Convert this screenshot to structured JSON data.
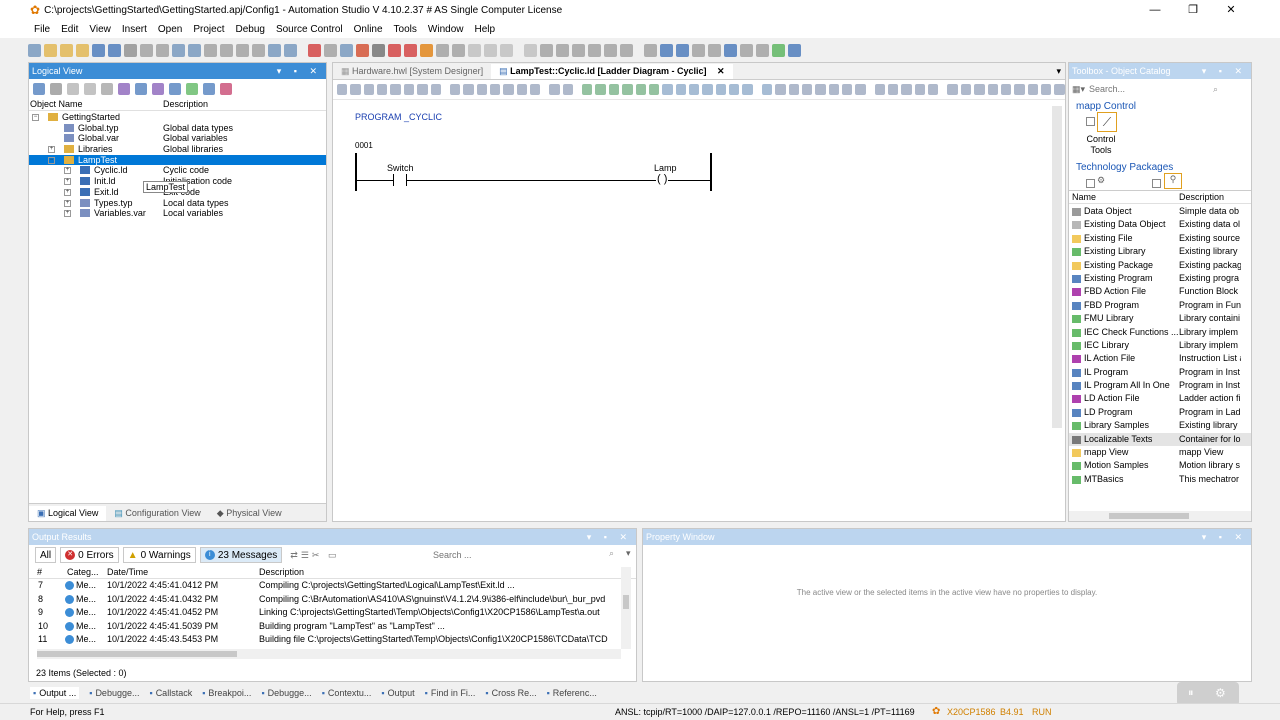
{
  "window": {
    "title": "C:\\projects\\GettingStarted\\GettingStarted.apj/Config1 - Automation Studio V 4.10.2.37 # AS Single Computer License",
    "minimize": "—",
    "maximize": "❐",
    "close": "✕"
  },
  "menu": [
    "File",
    "Edit",
    "View",
    "Insert",
    "Open",
    "Project",
    "Debug",
    "Source Control",
    "Online",
    "Tools",
    "Window",
    "Help"
  ],
  "logical_view": {
    "title": "Logical View",
    "col_object": "Object Name",
    "col_desc": "Description",
    "items": [
      {
        "name": "GettingStarted",
        "desc": "",
        "indent": 0,
        "expander": "−"
      },
      {
        "name": "Global.typ",
        "desc": "Global data types",
        "indent": 1,
        "expander": ""
      },
      {
        "name": "Global.var",
        "desc": "Global variables",
        "indent": 1,
        "expander": ""
      },
      {
        "name": "Libraries",
        "desc": "Global libraries",
        "indent": 1,
        "expander": "+"
      },
      {
        "name": "LampTest",
        "desc": "",
        "indent": 1,
        "expander": "−"
      },
      {
        "name": "Cyclic.ld",
        "desc": "Cyclic code",
        "indent": 2,
        "expander": "+"
      },
      {
        "name": "Init.ld",
        "desc": "Initialisation code",
        "indent": 2,
        "expander": "+"
      },
      {
        "name": "Exit.ld",
        "desc": "Exit code",
        "indent": 2,
        "expander": "+"
      },
      {
        "name": "Types.typ",
        "desc": "Local data types",
        "indent": 2,
        "expander": "+"
      },
      {
        "name": "Variables.var",
        "desc": "Local variables",
        "indent": 2,
        "expander": "+"
      }
    ],
    "tooltip": "LampTest",
    "tabs": [
      "Logical View",
      "Configuration View",
      "Physical View"
    ]
  },
  "editor": {
    "tabs": [
      "Hardware.hwl [System Designer]",
      "LampTest::Cyclic.ld [Ladder Diagram - Cyclic]"
    ],
    "tab_close": "✕",
    "program_label": "PROGRAM _CYCLIC",
    "network": "0001",
    "contact": "Switch",
    "coil": "Lamp",
    "coil_symbol": "( )"
  },
  "toolbox": {
    "title": "Toolbox - Object Catalog",
    "search_placeholder": "Search...",
    "section1": "mapp Control",
    "control_tools": "Control Tools",
    "section2": "Technology Packages",
    "col_name": "Name",
    "col_desc": "Description",
    "items": [
      {
        "name": "Data Object",
        "desc": "Simple data ob",
        "color": "#888888"
      },
      {
        "name": "Existing Data Object",
        "desc": "Existing data ol",
        "color": "#aaaaaa"
      },
      {
        "name": "Existing File",
        "desc": "Existing source",
        "color": "#f0c040"
      },
      {
        "name": "Existing Library",
        "desc": "Existing library",
        "color": "#4caf50"
      },
      {
        "name": "Existing Package",
        "desc": "Existing packag",
        "color": "#f0c040"
      },
      {
        "name": "Existing Program",
        "desc": "Existing progra",
        "color": "#3b6fb5"
      },
      {
        "name": "FBD Action File",
        "desc": "Function Block",
        "color": "#a020a0"
      },
      {
        "name": "FBD Program",
        "desc": "Program in Fun",
        "color": "#3b6fb5"
      },
      {
        "name": "FMU Library",
        "desc": "Library containi",
        "color": "#4caf50"
      },
      {
        "name": "IEC Check Functions ...",
        "desc": "Library implem",
        "color": "#4caf50"
      },
      {
        "name": "IEC Library",
        "desc": "Library implem",
        "color": "#4caf50"
      },
      {
        "name": "IL Action File",
        "desc": "Instruction List a",
        "color": "#a020a0"
      },
      {
        "name": "IL Program",
        "desc": "Program in Inst",
        "color": "#3b6fb5"
      },
      {
        "name": "IL Program All In One",
        "desc": "Program in Inst",
        "color": "#3b6fb5"
      },
      {
        "name": "LD Action File",
        "desc": "Ladder action fi",
        "color": "#a020a0"
      },
      {
        "name": "LD Program",
        "desc": "Program in Lad",
        "color": "#3b6fb5"
      },
      {
        "name": "Library Samples",
        "desc": "Existing library",
        "color": "#4caf50"
      },
      {
        "name": "Localizable Texts",
        "desc": "Container for lo",
        "color": "#666666"
      },
      {
        "name": "mapp View",
        "desc": "mapp View",
        "color": "#f0c040"
      },
      {
        "name": "Motion Samples",
        "desc": "Motion library s",
        "color": "#4caf50"
      },
      {
        "name": "MTBasics",
        "desc": "This mechatror",
        "color": "#4caf50"
      }
    ]
  },
  "output": {
    "title": "Output Results",
    "filter_all": "All",
    "errors": "0 Errors",
    "warnings": "0 Warnings",
    "messages": "23 Messages",
    "search_placeholder": "Search ...",
    "cols": [
      "#",
      "Categ...",
      "Date/Time",
      "Description"
    ],
    "rows": [
      {
        "n": "7",
        "cat": "Me...",
        "time": "10/1/2022 4:45:41.0412 PM",
        "desc": "Compiling C:\\projects\\GettingStarted\\Logical\\LampTest\\Exit.ld ..."
      },
      {
        "n": "8",
        "cat": "Me...",
        "time": "10/1/2022 4:45:41.0432 PM",
        "desc": "Compiling C:\\BrAutomation\\AS410\\AS\\gnuinst\\V4.1.2\\4.9\\i386-elf\\include\\bur\\_bur_pvd"
      },
      {
        "n": "9",
        "cat": "Me...",
        "time": "10/1/2022 4:45:41.0452 PM",
        "desc": "Linking C:\\projects\\GettingStarted\\Temp\\Objects\\Config1\\X20CP1586\\LampTest\\a.out"
      },
      {
        "n": "10",
        "cat": "Me...",
        "time": "10/1/2022 4:45:41.5039 PM",
        "desc": "Building program \"LampTest\" as \"LampTest\" ..."
      },
      {
        "n": "11",
        "cat": "Me...",
        "time": "10/1/2022 4:45:43.5453 PM",
        "desc": "Building file C:\\projects\\GettingStarted\\Temp\\Objects\\Config1\\X20CP1586\\TCData\\TCD"
      }
    ],
    "summary": "23 Items (Selected : 0)"
  },
  "property": {
    "title": "Property Window",
    "empty": "The active view or the selected items in the active view have no properties to display."
  },
  "bottom_tabs": [
    "Output ...",
    "Debugge...",
    "Callstack",
    "Breakpoi...",
    "Debugge...",
    "Contextu...",
    "Output",
    "Find in Fi...",
    "Cross Re...",
    "Referenc..."
  ],
  "status": {
    "help": "For Help, press F1",
    "connection": "ANSL: tcpip/RT=1000 /DAIP=127.0.0.1 /REPO=11160 /ANSL=1 /PT=11169",
    "cpu": "X20CP1586",
    "version": "B4.91",
    "mode": "RUN"
  },
  "colors": {
    "accent": "#3c8dd6",
    "selection": "#0078d7",
    "cpu_text": "#d08000"
  }
}
